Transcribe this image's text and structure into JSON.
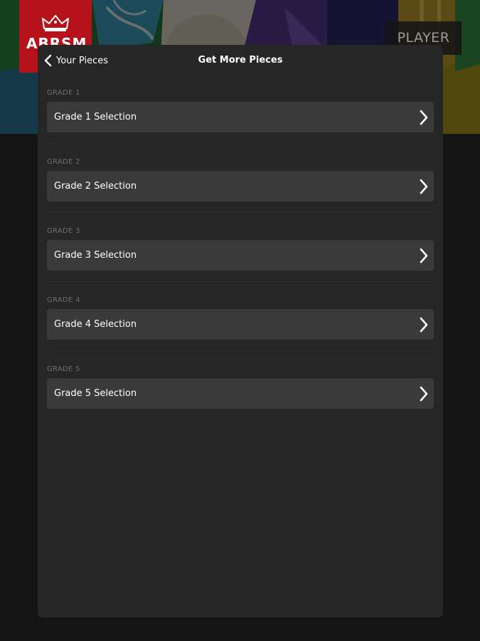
{
  "brand": {
    "logo_text": "ABRSM",
    "player_label": "PLAYER"
  },
  "nav": {
    "back_label": "Your Pieces",
    "title": "Get More Pieces"
  },
  "sections": [
    {
      "header": "GRADE 1",
      "item": "Grade 1 Selection"
    },
    {
      "header": "GRADE 2",
      "item": "Grade 2 Selection"
    },
    {
      "header": "GRADE 3",
      "item": "Grade 3 Selection"
    },
    {
      "header": "GRADE 4",
      "item": "Grade 4 Selection"
    },
    {
      "header": "GRADE 5",
      "item": "Grade 5 Selection"
    }
  ],
  "colors": {
    "logo_red": "#b5121b",
    "panel_bg": "#262626",
    "row_bg": "#3a3a3a",
    "header_text": "#6e6e6e"
  },
  "icons": {
    "back": "chevron-left-icon",
    "row": "chevron-right-icon",
    "logo": "crown-icon"
  }
}
